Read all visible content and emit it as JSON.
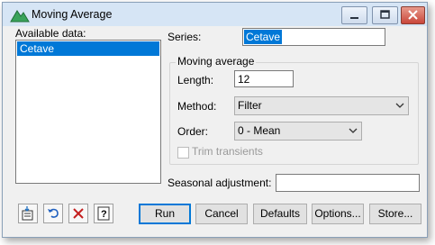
{
  "window": {
    "title": "Moving Average"
  },
  "available_data": {
    "label": "Available data:",
    "items": [
      "Cetave"
    ]
  },
  "series": {
    "label": "Series:",
    "value": "Cetave"
  },
  "moving_average": {
    "group_label": "Moving average",
    "length_label": "Length:",
    "length_value": "12",
    "method_label": "Method:",
    "method_value": "Filter",
    "order_label": "Order:",
    "order_value": "0 - Mean",
    "trim_label": "Trim transients"
  },
  "seasonal": {
    "label": "Seasonal adjustment:",
    "value": ""
  },
  "buttons": {
    "run": "Run",
    "cancel": "Cancel",
    "defaults": "Defaults",
    "options": "Options...",
    "store": "Store..."
  },
  "icons": [
    "moving-average-app-icon",
    "minimize-icon",
    "maximize-icon",
    "close-icon",
    "store-data-icon",
    "undo-icon",
    "clear-icon",
    "help-icon"
  ],
  "colors": {
    "selection": "#0078d7",
    "default_button_border": "#0078d7",
    "titlebar": "#d6e5f5"
  }
}
